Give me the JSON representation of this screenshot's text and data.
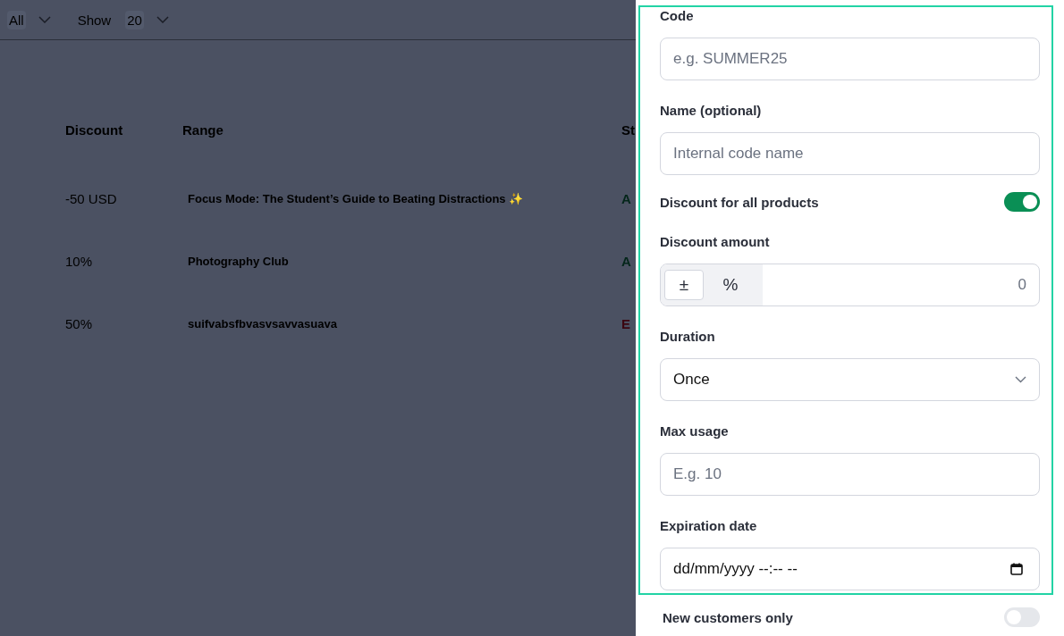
{
  "filters": {
    "type": {
      "value": "All"
    },
    "page_size": {
      "label": "Show",
      "value": "20"
    }
  },
  "table": {
    "columns": [
      "Discount",
      "Range",
      "St"
    ],
    "rows": [
      {
        "discount": "-50 USD",
        "range": "Focus Mode: The Student’s Guide to Beating Distractions ✨",
        "status": "A",
        "color": "#04261a"
      },
      {
        "discount": "10%",
        "range": "Photography Club",
        "status": "A",
        "color": "#04261a"
      },
      {
        "discount": "50%",
        "range": "suifvabsfbvasvsavvasuava",
        "status": "E",
        "color": "#3a0610"
      }
    ]
  },
  "form": {
    "code": {
      "label": "Code",
      "placeholder": "e.g. SUMMER25"
    },
    "name": {
      "label": "Name (optional)",
      "placeholder": "Internal code name"
    },
    "all_products": {
      "label": "Discount for all products",
      "on": true
    },
    "amount": {
      "label": "Discount amount",
      "types": [
        {
          "label": "±",
          "selected": true
        },
        {
          "label": "%",
          "selected": false
        }
      ],
      "value": "0"
    },
    "duration": {
      "label": "Duration",
      "value": "Once"
    },
    "max_usage": {
      "label": "Max usage",
      "placeholder": "E.g. 10"
    },
    "expiration": {
      "label": "Expiration date",
      "placeholder": "dd/mm/yyyy --:-- --"
    },
    "new_customers": {
      "label": "New customers only",
      "on": false
    }
  }
}
